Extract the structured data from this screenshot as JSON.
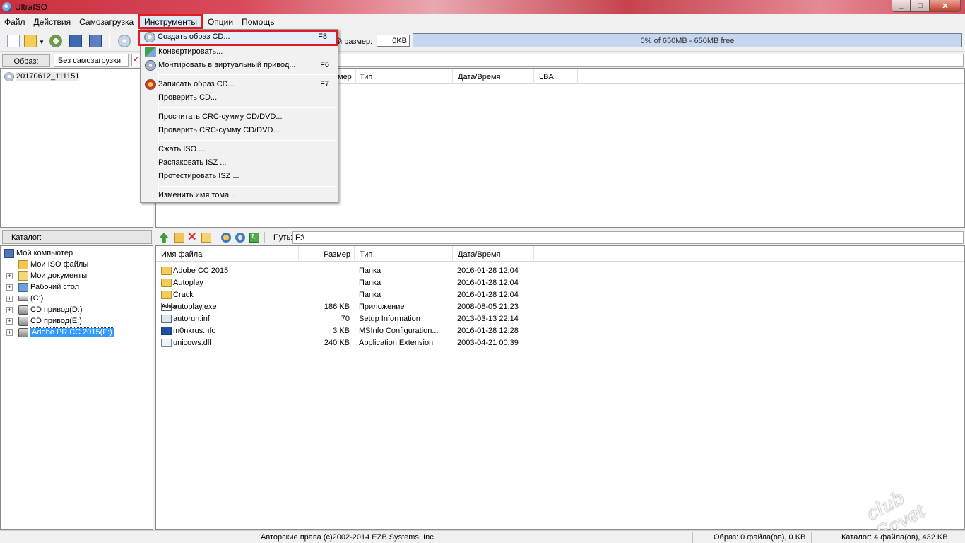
{
  "window": {
    "title": "UltraISO"
  },
  "menubar": [
    "Файл",
    "Действия",
    "Самозагрузка",
    "Инструменты",
    "Опции",
    "Помощь"
  ],
  "toolbar": {
    "size_label": "й размер:",
    "size_value": "0KB",
    "capacity_text": "0% of 650MB - 650MB free",
    "capacity_percent": 0
  },
  "image_row": {
    "label": "Образ:",
    "boot_value": "Без самозагрузки"
  },
  "iso_tree": {
    "root": "20170612_111151"
  },
  "iso_files": {
    "headers": [
      "мер",
      "Тип",
      "Дата/Время",
      "LBA"
    ]
  },
  "catalog": {
    "label": "Каталог:",
    "path_label": "Путь:",
    "path_value": "F:\\",
    "tree": [
      {
        "label": "Мой компьютер",
        "icon": "computer-icon"
      },
      {
        "label": "Мои ISO файлы",
        "icon": "iso-folder-icon"
      },
      {
        "label": "Мои документы",
        "icon": "documents-icon"
      },
      {
        "label": "Рабочий стол",
        "icon": "desktop-icon"
      },
      {
        "label": "(C:)",
        "icon": "drive-icon"
      },
      {
        "label": "CD привод(D:)",
        "icon": "cd-drive-icon"
      },
      {
        "label": "CD привод(E:)",
        "icon": "cd-drive-icon"
      },
      {
        "label": "Adobe PR CC 2015(F:)",
        "icon": "cd-drive-icon"
      }
    ]
  },
  "files": {
    "headers": [
      "Имя файла",
      "Размер",
      "Тип",
      "Дата/Время"
    ],
    "rows": [
      {
        "name": "Adobe CC 2015",
        "size": "",
        "type": "Папка",
        "date": "2016-01-28 12:04",
        "icon": "folder-icon"
      },
      {
        "name": "Autoplay",
        "size": "",
        "type": "Папка",
        "date": "2016-01-28 12:04",
        "icon": "folder-icon"
      },
      {
        "name": "Crack",
        "size": "",
        "type": "Папка",
        "date": "2016-01-28 12:04",
        "icon": "folder-icon"
      },
      {
        "name": "autoplay.exe",
        "size": "186 KB",
        "type": "Приложение",
        "date": "2008-08-05 21:23",
        "icon": "adobe-exe-icon"
      },
      {
        "name": "autorun.inf",
        "size": "70",
        "type": "Setup Information",
        "date": "2013-03-13 22:14",
        "icon": "inf-file-icon"
      },
      {
        "name": "m0nkrus.nfo",
        "size": "3 KB",
        "type": "MSInfo Configuration...",
        "date": "2016-01-28 12:28",
        "icon": "nfo-file-icon"
      },
      {
        "name": "unicows.dll",
        "size": "240 KB",
        "type": "Application Extension",
        "date": "2003-04-21 00:39",
        "icon": "dll-file-icon"
      }
    ]
  },
  "dropdown": {
    "items": [
      {
        "label": "Создать образ CD...",
        "shortcut": "F8",
        "icon": "cd-image-icon"
      },
      {
        "label": "Конвертировать...",
        "shortcut": "",
        "icon": "convert-icon"
      },
      {
        "label": "Монтировать в виртуальный привод...",
        "shortcut": "F6",
        "icon": "mount-icon"
      },
      {
        "label": "Записать образ CD...",
        "shortcut": "F7",
        "icon": "burn-icon"
      },
      {
        "label": "Проверить CD...",
        "shortcut": ""
      },
      {
        "label": "Просчитать CRC-сумму CD/DVD...",
        "shortcut": ""
      },
      {
        "label": "Проверить CRC-сумму CD/DVD...",
        "shortcut": ""
      },
      {
        "label": "Сжать ISO ...",
        "shortcut": ""
      },
      {
        "label": "Распаковать ISZ ...",
        "shortcut": ""
      },
      {
        "label": "Протестировать ISZ ...",
        "shortcut": ""
      },
      {
        "label": "Изменить имя тома...",
        "shortcut": ""
      }
    ]
  },
  "statusbar": {
    "copyright": "Авторские права (c)2002-2014 EZB Systems, Inc.",
    "image_info": "Образ: 0 файла(ов), 0 KB",
    "catalog_info": "Каталог: 4 файла(ов), 432 KB"
  },
  "watermark": "club Sovet",
  "colors": {
    "highlight_red": "#e21a22",
    "selection_blue": "#3399ff",
    "title_bar": "#c9303f"
  }
}
